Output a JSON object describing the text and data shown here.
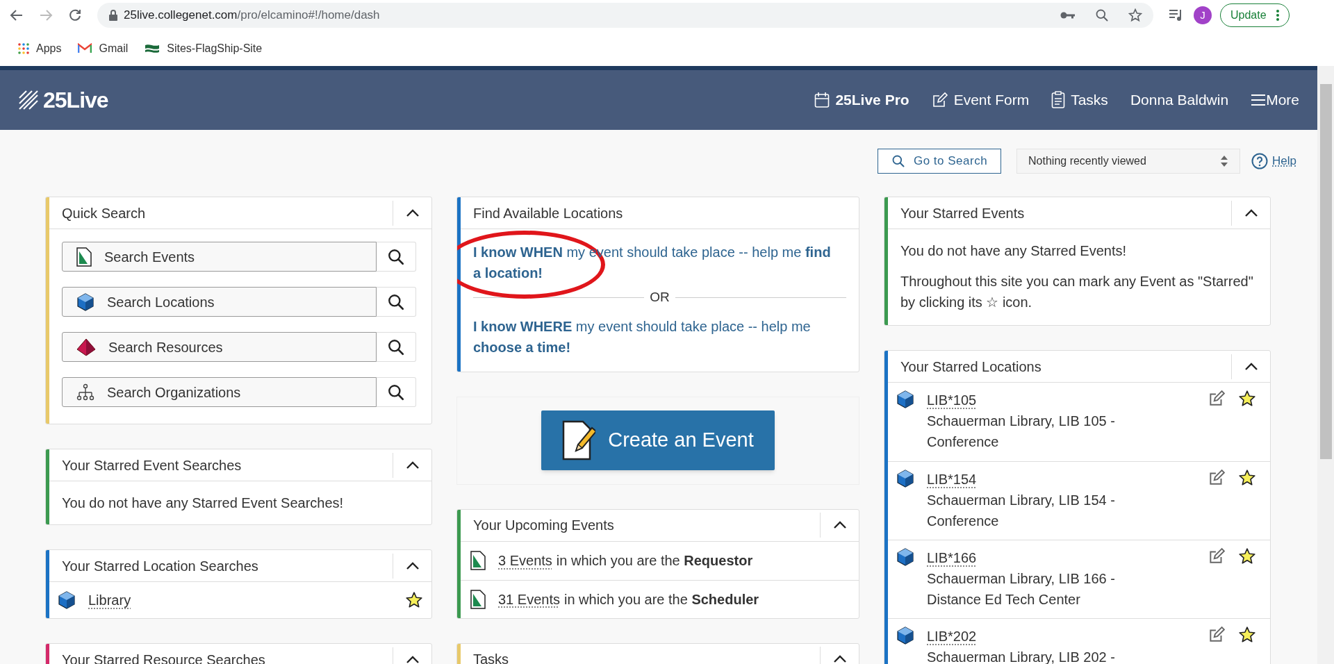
{
  "browser": {
    "url_host": "25live.collegenet.com",
    "url_path": "/pro/elcamino#!/home/dash",
    "profile_initial": "J",
    "update_label": "Update",
    "bookmarks": [
      {
        "label": "Apps",
        "kind": "apps"
      },
      {
        "label": "Gmail",
        "kind": "gmail"
      },
      {
        "label": "Sites-FlagShip-Site",
        "kind": "site"
      }
    ]
  },
  "header": {
    "logo": "25Live",
    "nav": [
      {
        "label": "25Live Pro",
        "kind": "pro"
      },
      {
        "label": "Event Form",
        "kind": "form"
      },
      {
        "label": "Tasks",
        "kind": "tasks"
      },
      {
        "label": "Donna Baldwin",
        "kind": "user"
      },
      {
        "label": "More",
        "kind": "more"
      }
    ]
  },
  "toolbar": {
    "search_button": "Go to Search",
    "recent_select": "Nothing recently viewed",
    "help": "Help"
  },
  "columns": [
    [
      {
        "kind": "quick_search",
        "title": "Quick Search",
        "color": "#e8c96a",
        "expanded": true,
        "items": [
          {
            "label": "Search Events",
            "kind": "event"
          },
          {
            "label": "Search Locations",
            "kind": "location"
          },
          {
            "label": "Search Resources",
            "kind": "resource"
          },
          {
            "label": "Search Organizations",
            "kind": "organization"
          }
        ]
      },
      {
        "kind": "message",
        "title": "Your Starred Event Searches",
        "color": "#3c9a50",
        "expanded": true,
        "paragraphs": [
          "You do not have any Starred Event Searches!"
        ]
      },
      {
        "kind": "saved_searches",
        "title": "Your Starred Location Searches",
        "color": "#1c73c4",
        "expanded": true,
        "items": [
          {
            "label": "Library",
            "starred": true
          }
        ]
      },
      {
        "kind": "message",
        "title": "Your Starred Resource Searches",
        "color": "#d42a6a",
        "expanded": true
      }
    ],
    [
      {
        "kind": "find_locations",
        "title": "Find Available Locations",
        "color": "#1c73c4",
        "when": "**I know WHEN** my event should take place -- help me **find a location!**",
        "or": "OR",
        "where": "**I know WHERE** my event should take place -- help me **choose a time!**"
      },
      {
        "kind": "create_event",
        "label": "Create an Event"
      },
      {
        "kind": "upcoming",
        "title": "Your Upcoming Events",
        "color": "#3c9a50",
        "expanded": true,
        "items": [
          {
            "link": "3 Events",
            "text": "in which you are the **Requestor**"
          },
          {
            "link": "31 Events",
            "text": "in which you are the **Scheduler**"
          }
        ]
      },
      {
        "kind": "message",
        "title": "Tasks",
        "color": "#e8c96a",
        "expanded": true
      }
    ],
    [
      {
        "kind": "starred_events",
        "title": "Your Starred Events",
        "color": "#3c9a50",
        "expanded": true,
        "message": "You do not have any Starred Events!",
        "hint": "Throughout this site you can mark any Event as \"Starred\" by clicking its ☆ icon."
      },
      {
        "kind": "starred_locations",
        "title": "Your Starred Locations",
        "color": "#1c73c4",
        "expanded": true,
        "items": [
          {
            "code": "LIB*105",
            "description": "Schauerman Library, LIB 105 - Conference",
            "starred": true
          },
          {
            "code": "LIB*154",
            "description": "Schauerman Library, LIB 154 - Conference",
            "starred": true
          },
          {
            "code": "LIB*166",
            "description": "Schauerman Library, LIB 166 - Distance Ed Tech Center",
            "starred": true
          },
          {
            "code": "LIB*202",
            "description": "Schauerman Library, LIB 202 -",
            "starred": true
          }
        ]
      }
    ]
  ]
}
